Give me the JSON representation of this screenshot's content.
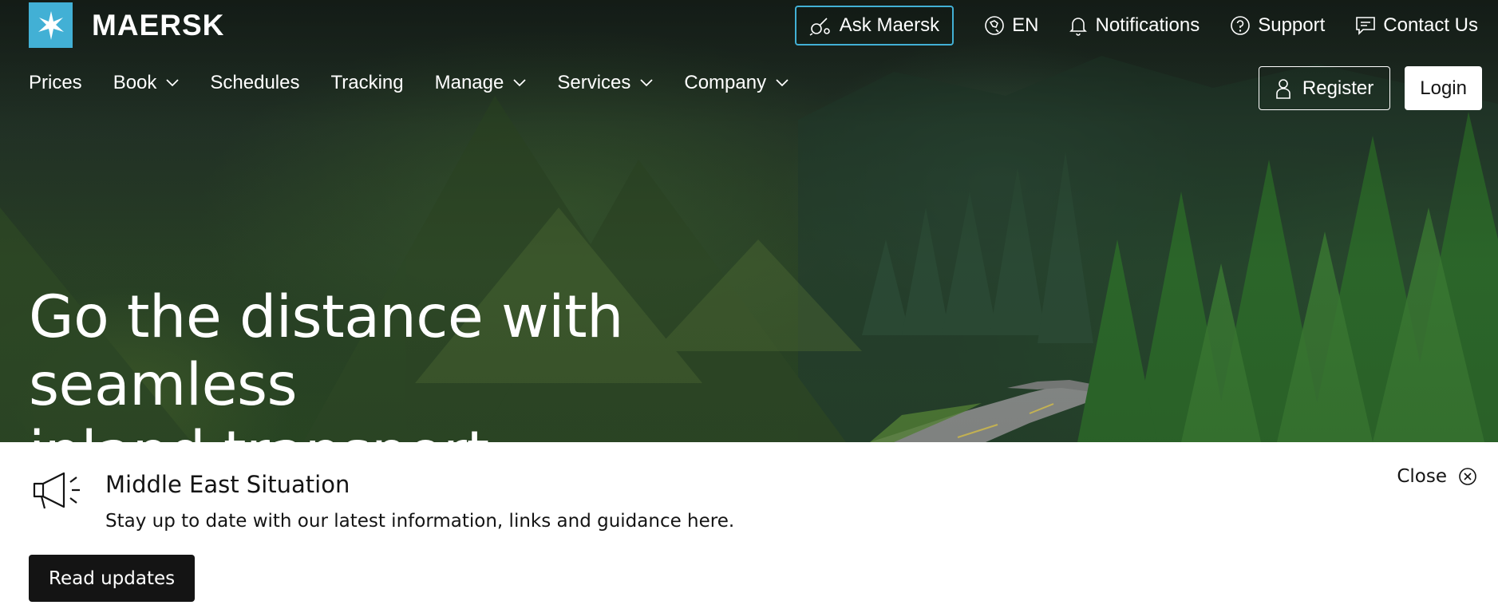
{
  "brand": {
    "name": "MAERSK",
    "logo_icon": "star-icon",
    "logo_color": "#42b0d5"
  },
  "utility": {
    "ask": {
      "label": "Ask Maersk",
      "icon": "ask-icon"
    },
    "language": {
      "label": "EN",
      "icon": "globe-icon"
    },
    "notifications": {
      "label": "Notifications",
      "icon": "bell-icon"
    },
    "support": {
      "label": "Support",
      "icon": "help-icon"
    },
    "contact": {
      "label": "Contact Us",
      "icon": "chat-icon"
    }
  },
  "nav": {
    "items": [
      {
        "label": "Prices",
        "dropdown": false
      },
      {
        "label": "Book",
        "dropdown": true
      },
      {
        "label": "Schedules",
        "dropdown": false
      },
      {
        "label": "Tracking",
        "dropdown": false
      },
      {
        "label": "Manage",
        "dropdown": true
      },
      {
        "label": "Services",
        "dropdown": true
      },
      {
        "label": "Company",
        "dropdown": true
      }
    ],
    "register_label": "Register",
    "login_label": "Login"
  },
  "hero": {
    "headline_line1": "Go the distance with seamless",
    "headline_line2": "inland transport"
  },
  "banner": {
    "icon": "megaphone-icon",
    "title": "Middle East Situation",
    "text": "Stay up to date with our latest information, links and guidance here.",
    "button_label": "Read updates",
    "close_label": "Close",
    "close_icon": "close-circle-icon"
  },
  "colors": {
    "accent": "#42b0d5",
    "dark": "#141414",
    "white": "#ffffff"
  }
}
